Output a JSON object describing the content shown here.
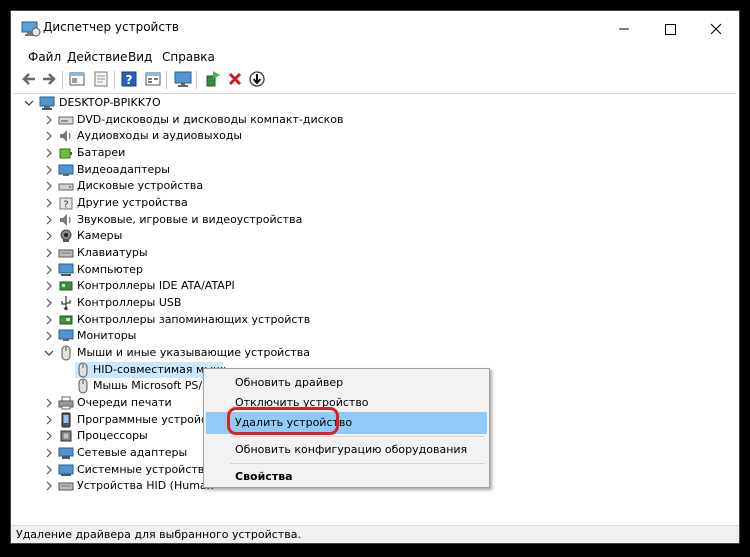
{
  "window": {
    "title": "Диспетчер устройств"
  },
  "menu": [
    "Файл",
    "Действие",
    "Вид",
    "Справка"
  ],
  "toolbar": [
    "back-icon",
    "forward-icon",
    "properties-icon",
    "update-icon",
    "help-icon",
    "view-icon",
    "monitor-icon",
    "add-driver-icon",
    "remove-icon",
    "download-icon"
  ],
  "tree": {
    "root": "DESKTOP-BPIKK7O",
    "categories": [
      "DVD-дисководы и дисководы компакт-дисков",
      "Аудиовходы и аудиовыходы",
      "Батареи",
      "Видеоадаптеры",
      "Дисковые устройства",
      "Другие устройства",
      "Звуковые, игровые и видеоустройства",
      "Камеры",
      "Клавиатуры",
      "Компьютер",
      "Контроллеры IDE ATA/ATAPI",
      "Контроллеры USB",
      "Контроллеры запоминающих устройств",
      "Мониторы",
      "Мыши и иные указывающие устройства"
    ],
    "mice_children": [
      "HID-совместимая мышь",
      "Мышь Microsoft PS/2"
    ],
    "categories_after": [
      "Очереди печати",
      "Программные устройства",
      "Процессоры",
      "Сетевые адаптеры",
      "Системные устройства",
      "Устройства HID (Human I"
    ]
  },
  "context_menu": {
    "items": [
      "Обновить драйвер",
      "Отключить устройство",
      "Удалить устройство",
      "Обновить конфигурацию оборудования",
      "Свойства"
    ]
  },
  "status": {
    "text": "Удаление драйвера для выбранного устройства."
  },
  "colors": {
    "selection": "#cce8ff",
    "highlight": "#e02020",
    "menu_hover": "#91c9f7"
  }
}
